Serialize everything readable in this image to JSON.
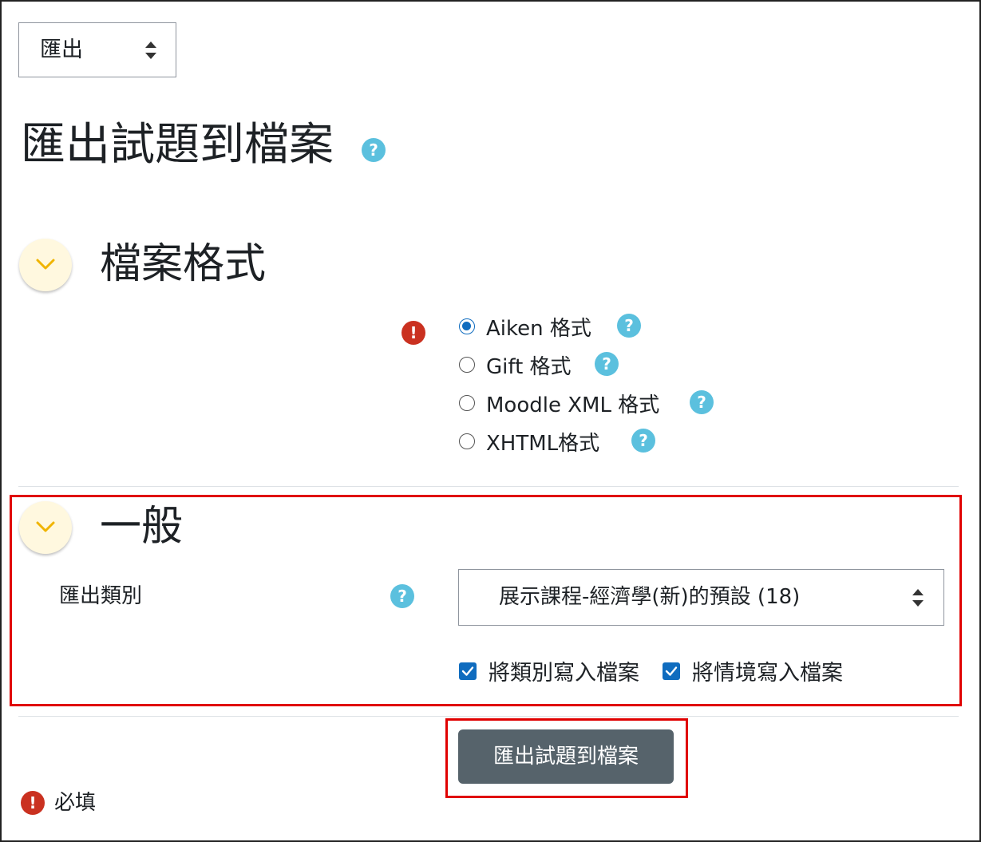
{
  "action_select": {
    "value": "匯出"
  },
  "page": {
    "title": "匯出試題到檔案",
    "help_icon": "?"
  },
  "sections": {
    "format": {
      "title": "檔案格式",
      "required_icon": "!",
      "options": [
        {
          "label": "Aiken 格式",
          "checked": true,
          "help_icon": "?"
        },
        {
          "label": "Gift 格式",
          "checked": false,
          "help_icon": "?"
        },
        {
          "label": "Moodle XML 格式",
          "checked": false,
          "help_icon": "?"
        },
        {
          "label": "XHTML格式",
          "checked": false,
          "help_icon": "?"
        }
      ]
    },
    "general": {
      "title": "一般",
      "category_label": "匯出類別",
      "category_help_icon": "?",
      "category_value": "展示課程-經濟學(新)的預設 (18)",
      "checkboxes": [
        {
          "label": "將類別寫入檔案",
          "checked": true
        },
        {
          "label": "將情境寫入檔案",
          "checked": true
        }
      ]
    }
  },
  "submit": {
    "label": "匯出試題到檔案"
  },
  "required_note": {
    "icon": "!",
    "text": "必填"
  },
  "colors": {
    "help": "#5bc0de",
    "required": "#ca3120",
    "primary_blue": "#0f6cbf",
    "button": "#56636b",
    "highlight_box": "#e00000",
    "collapse_bg": "#fff8df",
    "chevron": "#f0b400"
  },
  "icons": {
    "collapse": "chevron-down-icon",
    "select": "updown-arrows-icon",
    "help": "question-circle-icon",
    "required": "exclamation-circle-icon",
    "checkbox": "checkmark-icon"
  }
}
